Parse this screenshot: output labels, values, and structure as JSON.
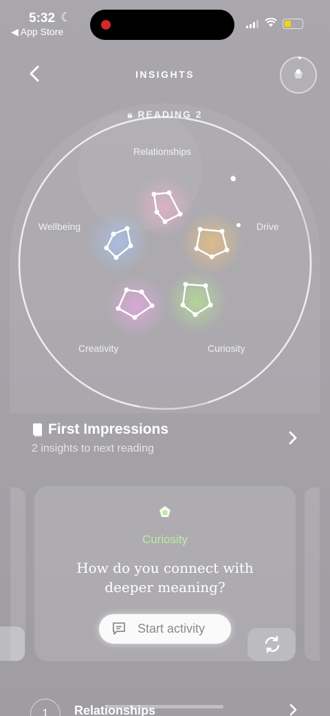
{
  "status_bar": {
    "time": "5:32",
    "back_app": "◀ App Store"
  },
  "header": {
    "title": "INSIGHTS"
  },
  "constellation": {
    "reading_label": "READING 2",
    "traits": [
      "Relationships",
      "Drive",
      "Curiosity",
      "Creativity",
      "Wellbeing"
    ],
    "colors": {
      "relationships": "#ffb3d1",
      "drive": "#ffc870",
      "curiosity": "#b9f08e",
      "creativity": "#f7a8f0",
      "wellbeing": "#a9c8ff"
    }
  },
  "first_impressions": {
    "title": "First Impressions",
    "subtitle": "2 insights to next reading"
  },
  "card": {
    "trait": "Curiosity",
    "question": "How do you connect with deeper meaning?",
    "start_label": "Start activity"
  },
  "list": {
    "items": [
      {
        "number": "1",
        "label": "Relationships"
      }
    ]
  }
}
